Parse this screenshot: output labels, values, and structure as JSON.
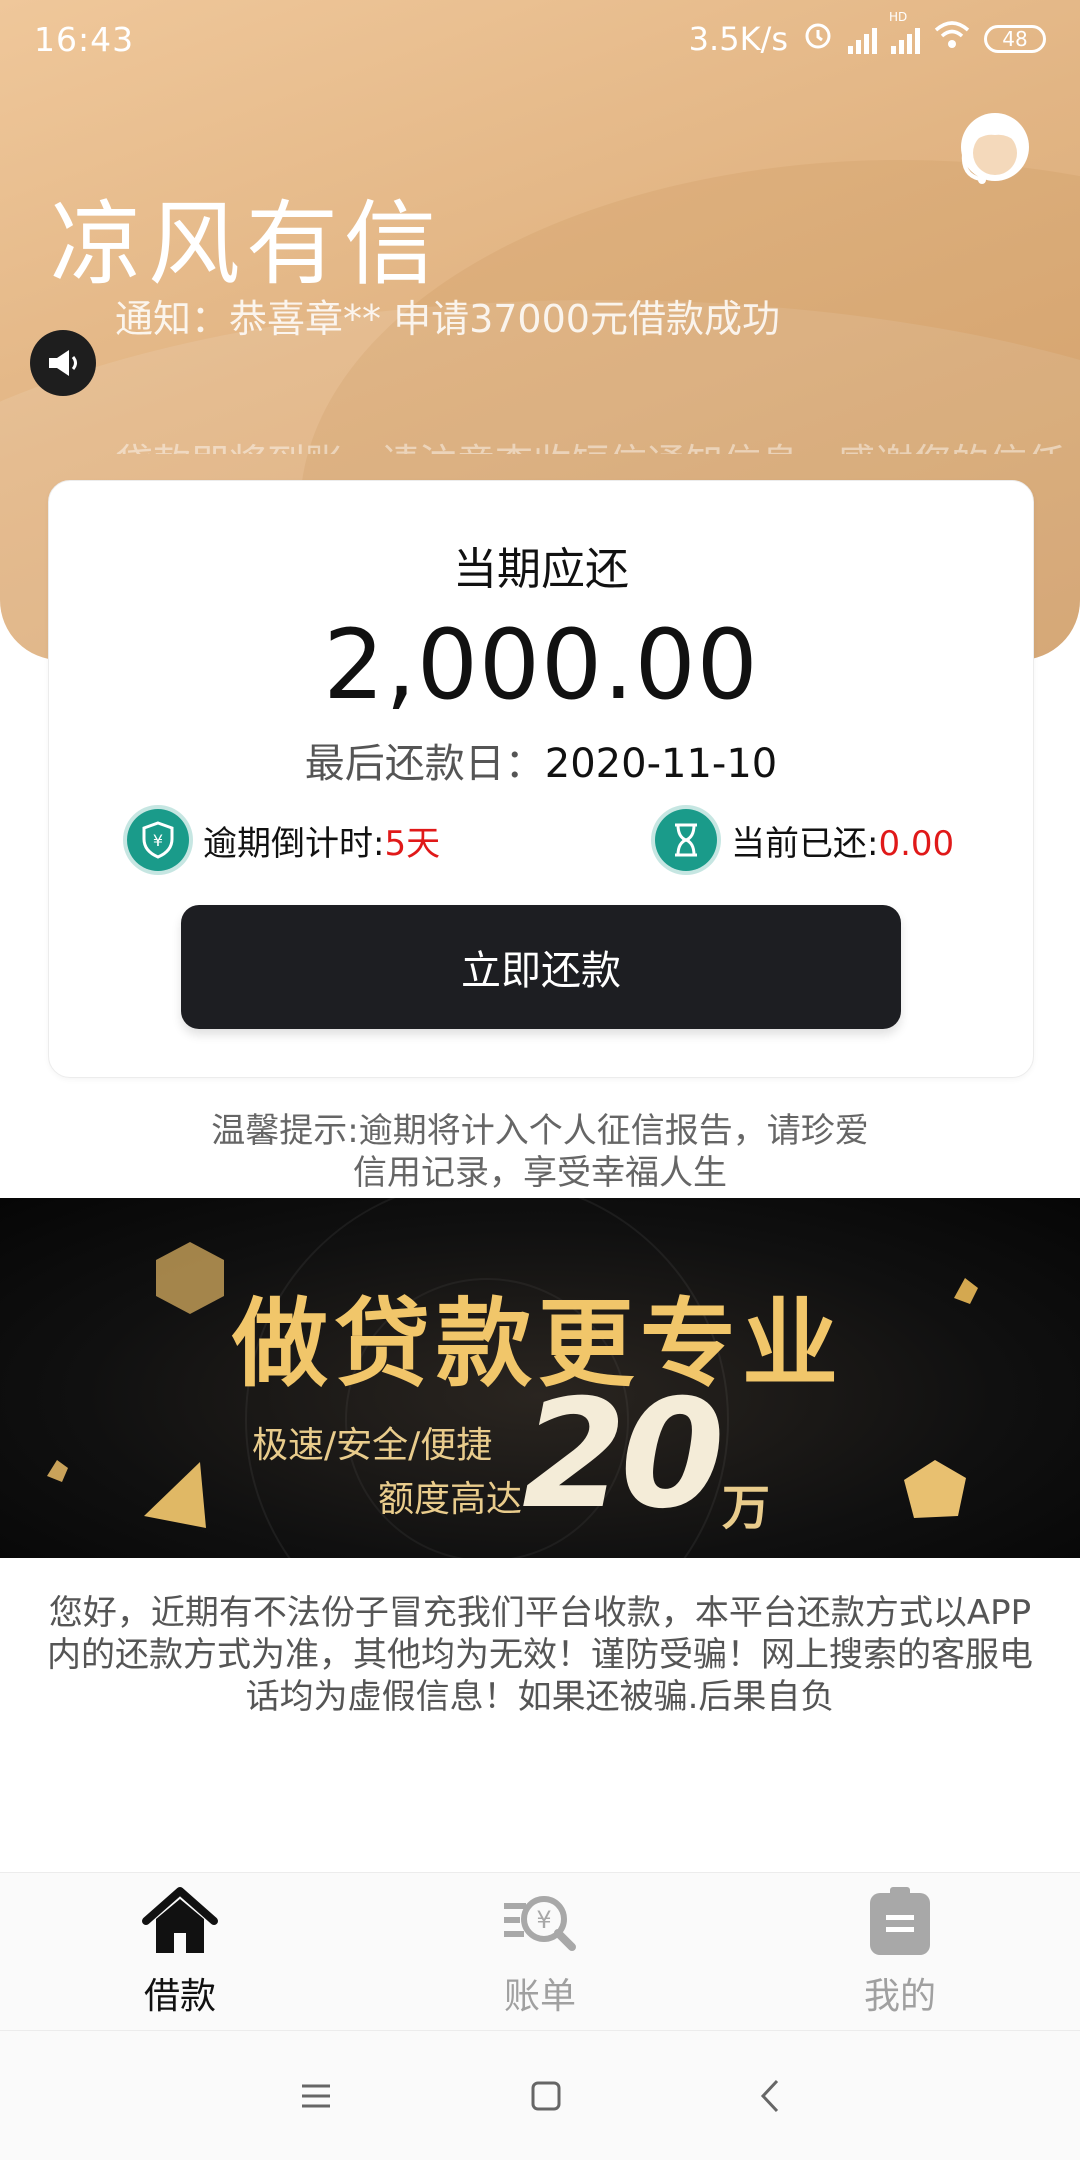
{
  "status_bar": {
    "time": "16:43",
    "net_speed": "3.5K/s",
    "hd": "HD",
    "battery": "48"
  },
  "header": {
    "app_title": "凉风有信",
    "notice": "通知：恭喜章** 申请37000元借款成功",
    "notice_next": "贷款即将到账，请注意查收短信通知信息，感谢您的信任"
  },
  "repayment_card": {
    "label": "当期应还",
    "amount": "2,000.00",
    "due_label": "最后还款日：",
    "due_date": "2020-11-10",
    "countdown_label": "逾期倒计时:",
    "countdown_value": "5天",
    "paid_label": "当前已还:",
    "paid_value": "0.00",
    "pay_button": "立即还款"
  },
  "tip": "温馨提示:逾期将计入个人征信报告，请珍爱信用记录，享受幸福人生",
  "banner": {
    "title": "做贷款更专业",
    "sub1": "极速/安全/便捷",
    "sub2": "额度高达",
    "amount": "20",
    "unit": "万"
  },
  "warning": "您好，近期有不法份子冒充我们平台收款，本平台还款方式以APP内的还款方式为准，其他均为无效！谨防受骗！网上搜索的客服电话均为虚假信息！如果还被骗.后果自负",
  "tabs": [
    {
      "label": "借款",
      "icon": "home-icon",
      "active": true
    },
    {
      "label": "账单",
      "icon": "bill-search-icon",
      "active": false
    },
    {
      "label": "我的",
      "icon": "clipboard-icon",
      "active": false
    }
  ],
  "colors": {
    "accent_red": "#e01919",
    "teal": "#1a9b8a",
    "header_gold": "#e2b584",
    "button_dark": "#1d1e22"
  }
}
